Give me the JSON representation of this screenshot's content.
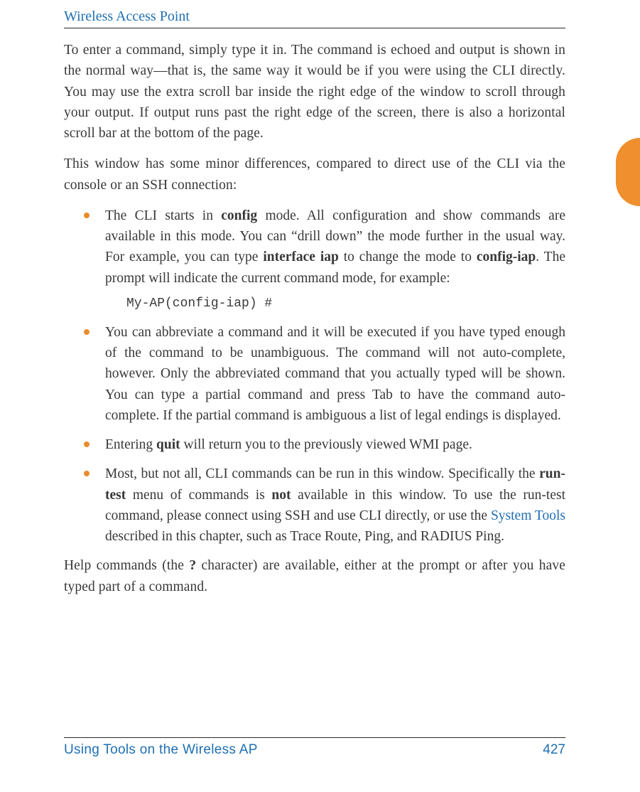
{
  "header": {
    "title": "Wireless Access Point"
  },
  "paragraphs": {
    "p1_a": "To enter a command, simply type it in. The command is echoed and output is shown in the normal way",
    "p1_dash": "—",
    "p1_b": "that is, the same way it would be if you were using the CLI directly. You may use the extra scroll bar inside the right edge of the window to scroll through your output. If output runs past the right edge of the screen, there is also a horizontal scroll bar at the bottom of the page.",
    "p2": "This window has some minor differences, compared to direct use of the CLI via the console or an SSH connection:",
    "p3_a": "Help commands (the ",
    "p3_q": "?",
    "p3_b": " character) are available, either at the prompt or after you have typed part of a command."
  },
  "bullets": {
    "b1_a": "The CLI starts in ",
    "b1_config": "config",
    "b1_b": " mode. All configuration and show commands are available in this mode. You can “drill down” the mode further in the usual way. For example, you can type ",
    "b1_iface": "interface iap",
    "b1_c": " to change the mode to ",
    "b1_cfgiap": "config-iap",
    "b1_d": ". The prompt will indicate the current command mode, for example:",
    "b1_code": "My-AP(config-iap) #",
    "b2": "You can abbreviate a command and it will be executed if you have typed enough of the command to be unambiguous. The command will not auto-complete, however. Only the abbreviated command that you actually typed will be shown. You can type a partial command and press Tab to have the command auto-complete. If the partial command is ambiguous a list of legal endings is displayed.",
    "b3_a": "Entering ",
    "b3_quit": "quit",
    "b3_b": " will return you to the previously viewed WMI page.",
    "b4_a": "Most, but not all, CLI commands can be run in this window. Specifically the ",
    "b4_run": "run-test",
    "b4_b": " menu of commands is ",
    "b4_not": "not",
    "b4_c": " available in this window. To use the run-test command, please connect using SSH and use CLI directly, or use the ",
    "b4_link": "System Tools",
    "b4_d": " described in this chapter, such as Trace Route, Ping, and RADIUS Ping."
  },
  "footer": {
    "left": "Using Tools on the Wireless AP",
    "page": "427"
  }
}
